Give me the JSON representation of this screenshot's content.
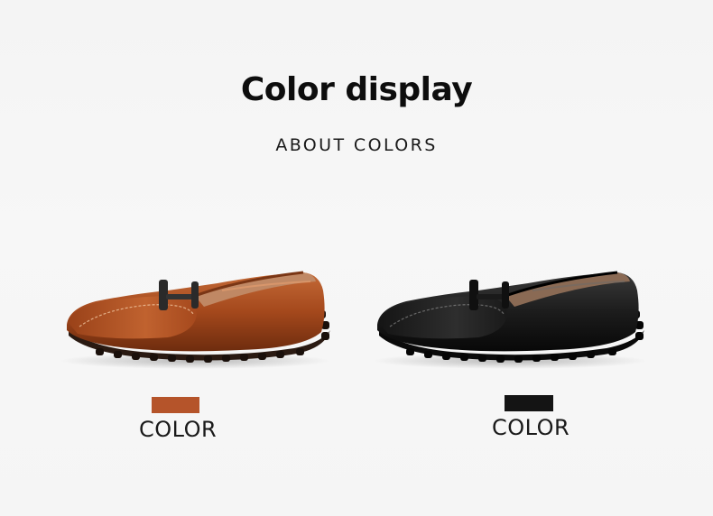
{
  "header": {
    "title": "Color display",
    "subtitle": "ABOUT COLORS"
  },
  "variants": [
    {
      "image": "brown-loafer-image",
      "swatch_color": "#b5542a",
      "label": "COLOR"
    },
    {
      "image": "black-loafer-image",
      "swatch_color": "#141414",
      "label": "COLOR"
    }
  ]
}
